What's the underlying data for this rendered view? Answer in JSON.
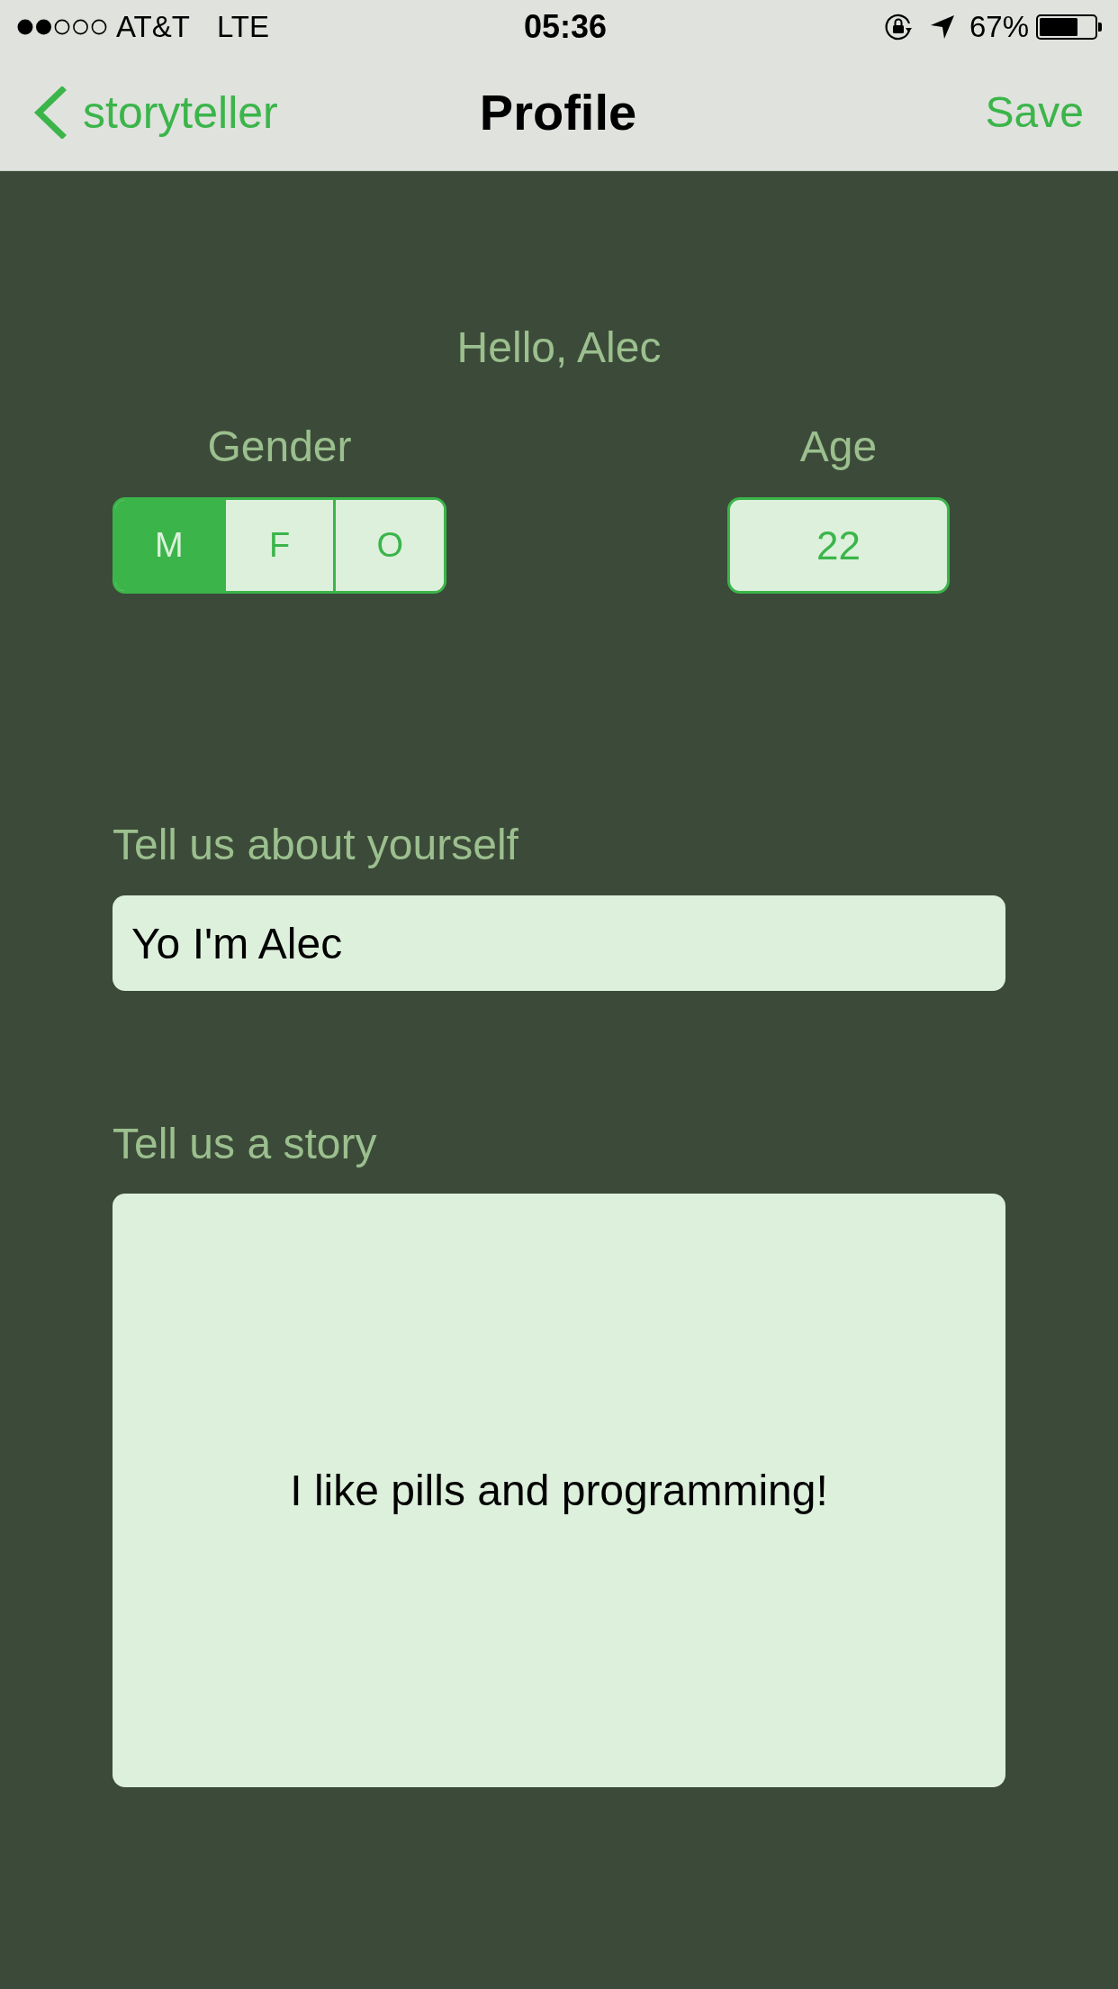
{
  "status_bar": {
    "carrier": "AT&T",
    "network": "LTE",
    "time": "05:36",
    "battery": "67%"
  },
  "nav_bar": {
    "back": "storyteller",
    "title": "Profile",
    "action": "Save"
  },
  "greeting": "Hello, Alec",
  "gender": {
    "label": "Gender",
    "options": [
      {
        "label": "M",
        "selected": true
      },
      {
        "label": "F",
        "selected": false
      },
      {
        "label": "O",
        "selected": false
      }
    ]
  },
  "age": {
    "label": "Age",
    "value": "22"
  },
  "about": {
    "label": "Tell us about yourself",
    "value": "Yo I'm Alec"
  },
  "story": {
    "label": "Tell us a story",
    "value": "I like pills and programming!"
  }
}
